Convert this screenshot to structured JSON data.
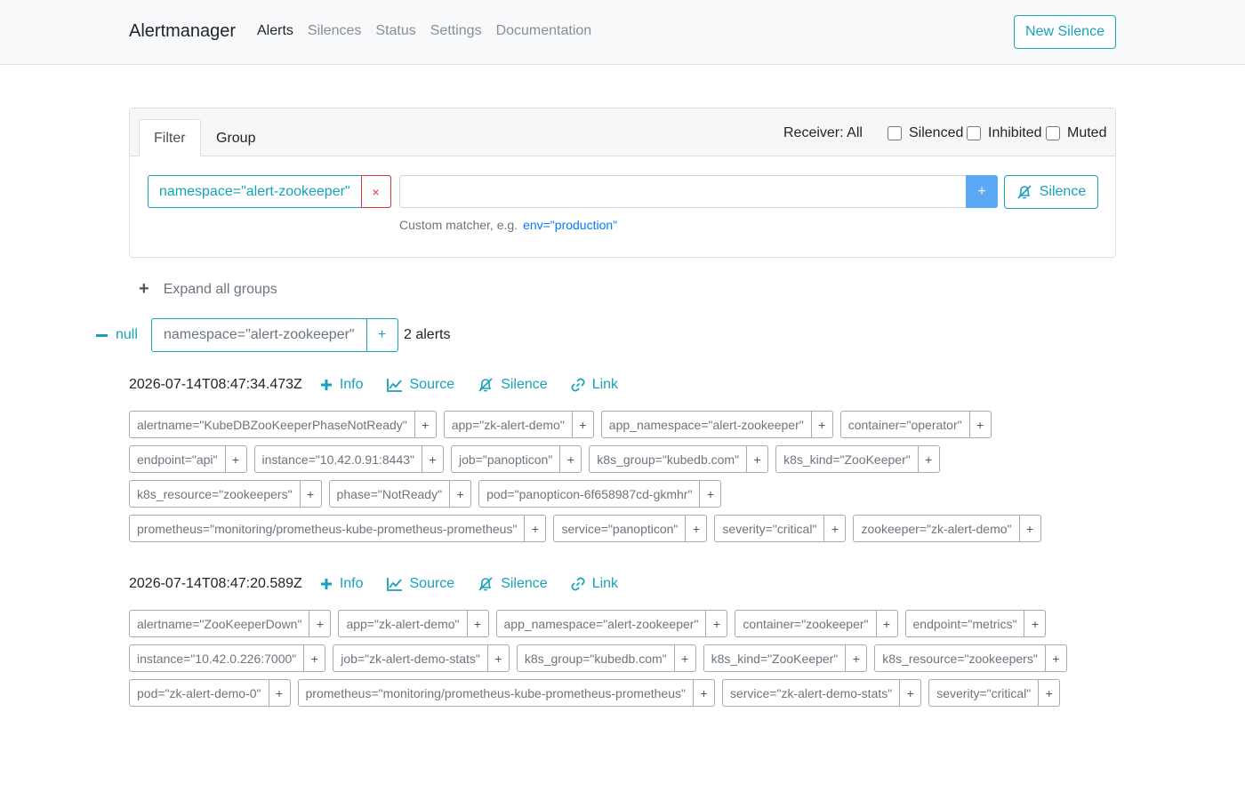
{
  "navbar": {
    "brand": "Alertmanager",
    "links": [
      "Alerts",
      "Silences",
      "Status",
      "Settings",
      "Documentation"
    ],
    "active": "Alerts",
    "new_silence": "New Silence"
  },
  "filter": {
    "tabs": [
      "Filter",
      "Group"
    ],
    "receiver": "Receiver: All",
    "checkboxes": [
      "Silenced",
      "Inhibited",
      "Muted"
    ],
    "matcher": "namespace=\"alert-zookeeper\"",
    "remove_symbol": "×",
    "add_symbol": "+",
    "silence_label": "Silence",
    "hint_text": "Custom matcher, e.g.",
    "hint_example": "env=\"production\""
  },
  "expand_label": "Expand all groups",
  "group": {
    "name": "null",
    "tag": "namespace=\"alert-zookeeper\"",
    "count": "2 alerts"
  },
  "actions": {
    "info": "Info",
    "source": "Source",
    "silence": "Silence",
    "link": "Link"
  },
  "alerts": [
    {
      "timestamp": "2026-07-14T08:47:34.473Z",
      "labels": [
        "alertname=\"KubeDBZooKeeperPhaseNotReady\"",
        "app=\"zk-alert-demo\"",
        "app_namespace=\"alert-zookeeper\"",
        "container=\"operator\"",
        "endpoint=\"api\"",
        "instance=\"10.42.0.91:8443\"",
        "job=\"panopticon\"",
        "k8s_group=\"kubedb.com\"",
        "k8s_kind=\"ZooKeeper\"",
        "k8s_resource=\"zookeepers\"",
        "phase=\"NotReady\"",
        "pod=\"panopticon-6f658987cd-gkmhr\"",
        "prometheus=\"monitoring/prometheus-kube-prometheus-prometheus\"",
        "service=\"panopticon\"",
        "severity=\"critical\"",
        "zookeeper=\"zk-alert-demo\""
      ]
    },
    {
      "timestamp": "2026-07-14T08:47:20.589Z",
      "labels": [
        "alertname=\"ZooKeeperDown\"",
        "app=\"zk-alert-demo\"",
        "app_namespace=\"alert-zookeeper\"",
        "container=\"zookeeper\"",
        "endpoint=\"metrics\"",
        "instance=\"10.42.0.226:7000\"",
        "job=\"zk-alert-demo-stats\"",
        "k8s_group=\"kubedb.com\"",
        "k8s_kind=\"ZooKeeper\"",
        "k8s_resource=\"zookeepers\"",
        "pod=\"zk-alert-demo-0\"",
        "prometheus=\"monitoring/prometheus-kube-prometheus-prometheus\"",
        "service=\"zk-alert-demo-stats\"",
        "severity=\"critical\""
      ]
    }
  ],
  "colors": {
    "accent": "#17a2b8",
    "danger": "#dc3545",
    "primary_btn": "#5ba8f7",
    "link": "#007bff"
  }
}
